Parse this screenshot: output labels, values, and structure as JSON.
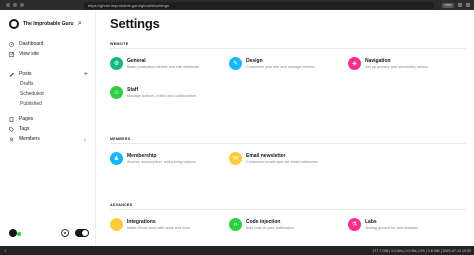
{
  "browser": {
    "url": "https://ghost.improbable.guru/ghost/#/settings",
    "badge": "125%"
  },
  "sidebar": {
    "site_name": "The Improbable Guru",
    "items": [
      {
        "label": "Dashboard",
        "icon": "dashboard-icon"
      },
      {
        "label": "View site",
        "icon": "external-icon"
      },
      {
        "label": "Posts",
        "icon": "posts-icon"
      },
      {
        "label": "Drafts"
      },
      {
        "label": "Scheduled"
      },
      {
        "label": "Published"
      },
      {
        "label": "Pages",
        "icon": "pages-icon"
      },
      {
        "label": "Tags",
        "icon": "tag-icon"
      },
      {
        "label": "Members",
        "icon": "members-icon",
        "count": "0"
      }
    ]
  },
  "main": {
    "title": "Settings",
    "sections": [
      {
        "label": "WEBSITE",
        "cards": [
          {
            "title": "General",
            "desc": "Basic publication details and site metadata",
            "color": "#14b886",
            "icon": "gear-icon"
          },
          {
            "title": "Design",
            "desc": "Customize your site and manage themes",
            "color": "#14b8ff",
            "icon": "brush-icon"
          },
          {
            "title": "Navigation",
            "desc": "Set up primary and secondary menus",
            "color": "#fb2d8d",
            "icon": "compass-icon"
          },
          {
            "title": "Staff",
            "desc": "Manage authors, editor and collaborators",
            "color": "#30cf43",
            "icon": "staff-icon"
          }
        ]
      },
      {
        "label": "MEMBERS",
        "cards": [
          {
            "title": "Membership",
            "desc": "Access, subscription, and pricing options",
            "color": "#14b8ff",
            "icon": "members-icon"
          },
          {
            "title": "Email newsletter",
            "desc": "Customize emails and set email addresses",
            "color": "#fecd3c",
            "icon": "mail-icon"
          }
        ]
      },
      {
        "label": "ADVANCED",
        "cards": [
          {
            "title": "Integrations",
            "desc": "Make Ghost work with apps and tools",
            "color": "#fecd3c",
            "icon": "plug-icon"
          },
          {
            "title": "Code injection",
            "desc": "Add code to your publication",
            "color": "#30cf43",
            "icon": "code-icon"
          },
          {
            "title": "Labs",
            "desc": "Testing ground for new features",
            "color": "#fb2d8d",
            "icon": "flask-icon"
          }
        ]
      }
    ]
  },
  "statusbar": {
    "workspace": "1",
    "stats": "177.7 GiB | 0.0 B/s | 0.0 B/s | 0% | 3.8 GiB | 2023-07-13 15:32"
  }
}
